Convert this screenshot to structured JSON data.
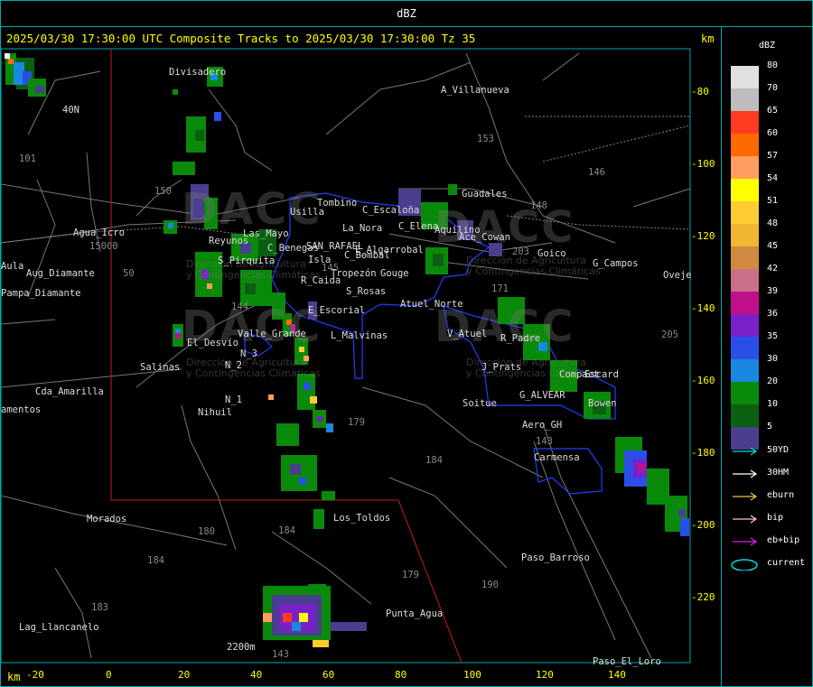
{
  "window": {
    "title": "dBZ"
  },
  "map": {
    "title": "2025/03/30 17:30:00 UTC Composite Tracks to 2025/03/30 17:30:00 Tz 35",
    "unit_right": "km",
    "unit_bottom": "km",
    "y_ticks": [
      "-80",
      "-100",
      "-120",
      "-140",
      "-160",
      "-180",
      "-200",
      "-220"
    ],
    "x_ticks": [
      "-20",
      "0",
      "20",
      "40",
      "60",
      "80",
      "100",
      "120",
      "140"
    ],
    "places": [
      "Divisadero",
      "A_Villanueva",
      "40N",
      "101",
      "153",
      "150",
      "Tombino",
      "Usilla",
      "C_Escaloña",
      "Guadales",
      "La_Nora",
      "C_Elena",
      "Agua_Icro",
      "Reyunos",
      "Las_Mayo",
      "C_Benegas",
      "SAN_RAFAEL",
      "E_Algarrobal",
      "Aquilino",
      "Ace_Cowan",
      "Goico",
      "G_Campos",
      "Aula",
      "Aug_Diamante",
      "S_Pirquita",
      "Isla",
      "C_Bombal",
      "Tropezón",
      "Gouge",
      "Oveje",
      "Pampa_Diamante",
      "R_Caida",
      "S_Rosas",
      "Atuel_Norte",
      "171",
      "144",
      "E_Escorial",
      "El_Desvío",
      "Valle_Grande",
      "L_Malvinas",
      "V_Atuel",
      "R_Padre",
      "205",
      "N_3",
      "N_2",
      "Salinas",
      "J_Prats",
      "Compact",
      "Escard",
      "Cda_Amarilla",
      "N_1",
      "Soitue",
      "G_ALVEAR",
      "Bowen",
      "amentos",
      "Nihuil",
      "179",
      "Aero_GH",
      "143",
      "184",
      "Carmensa",
      "Morados",
      "Los_Toldos",
      "180",
      "184",
      "184",
      "179",
      "190",
      "Paso_Barroso",
      "183",
      "Lag_Llancanelo",
      "Punta_Agua",
      "2200m",
      "143",
      "Paso_El_Loro",
      "146",
      "148",
      "203",
      "15000",
      "50",
      "145"
    ],
    "watermark": {
      "logo": "DACC",
      "line1": "Dirección de Agricultura",
      "line2": "y Contingencias Climáticas"
    }
  },
  "legend": {
    "title": "dBZ",
    "bins": [
      {
        "label": "80",
        "color": "#e0e0e0"
      },
      {
        "label": "70",
        "color": "#bdbdbd"
      },
      {
        "label": "65",
        "color": "#ff3b20"
      },
      {
        "label": "60",
        "color": "#ff6a00"
      },
      {
        "label": "57",
        "color": "#ff9e5e"
      },
      {
        "label": "54",
        "color": "#ffff00"
      },
      {
        "label": "51",
        "color": "#ffcc33"
      },
      {
        "label": "48",
        "color": "#f0b830"
      },
      {
        "label": "45",
        "color": "#d08a40"
      },
      {
        "label": "42",
        "color": "#c87088"
      },
      {
        "label": "39",
        "color": "#c0108c"
      },
      {
        "label": "36",
        "color": "#7a20c8"
      },
      {
        "label": "35",
        "color": "#2a4ee8"
      },
      {
        "label": "30",
        "color": "#1a88e0"
      },
      {
        "label": "20",
        "color": "#0a8a0a"
      },
      {
        "label": "10",
        "color": "#0a6010"
      },
      {
        "label": "5",
        "color": "#4a3e8e"
      }
    ],
    "tracks": [
      {
        "label": "50YD",
        "color": "#00e0e0"
      },
      {
        "label": "30HM",
        "color": "#ffffff"
      },
      {
        "label": "eburn",
        "color": "#f0c040"
      },
      {
        "label": "bip",
        "color": "#ffc0d0"
      },
      {
        "label": "eb+bip",
        "color": "#e020e0"
      },
      {
        "label": "current",
        "color": "#00e0e0"
      }
    ]
  }
}
